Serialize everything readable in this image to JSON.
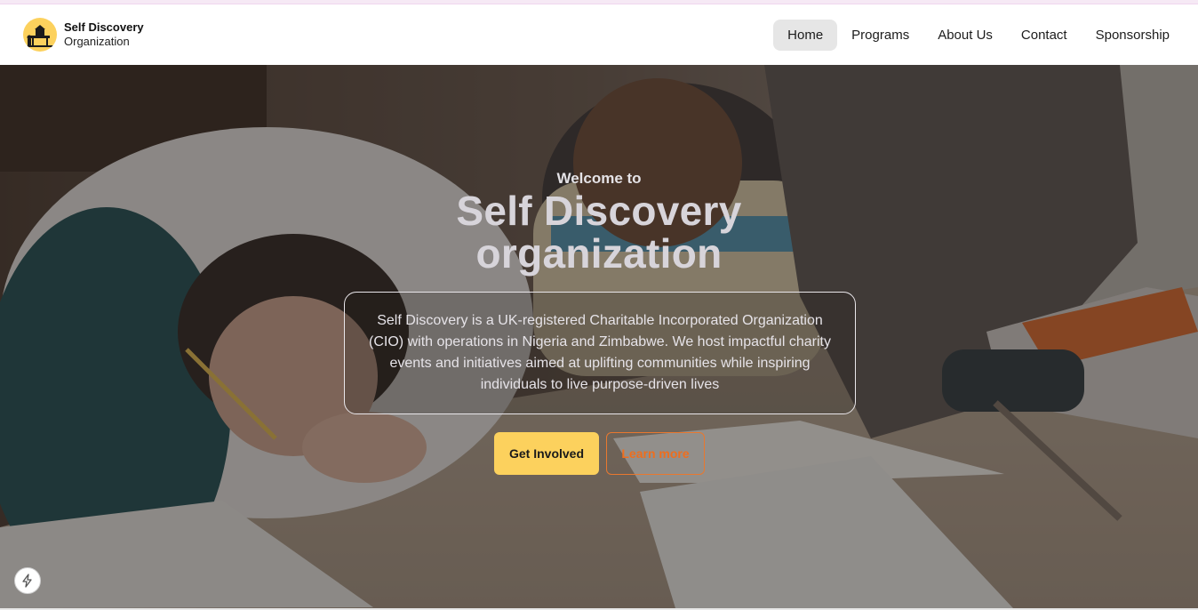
{
  "brand": {
    "name": "Self Discovery",
    "subtitle": "Organization",
    "logo_icon": "school-desk-logo-icon",
    "logo_color": "#fcd15d"
  },
  "nav": {
    "items": [
      {
        "label": "Home",
        "active": true
      },
      {
        "label": "Programs",
        "active": false
      },
      {
        "label": "About Us",
        "active": false
      },
      {
        "label": "Contact",
        "active": false
      },
      {
        "label": "Sponsorship",
        "active": false
      }
    ]
  },
  "hero": {
    "welcome": "Welcome to",
    "title_line1": "Self Discovery",
    "title_line2": "organization",
    "description": "Self Discovery is a UK-registered Charitable Incorporated Organization (CIO) with operations in Nigeria and Zimbabwe. We host impactful charity events and initiatives aimed at uplifting communities while inspiring individuals to live purpose-driven lives",
    "primary_button": "Get Involved",
    "secondary_button": "Learn more",
    "background_icon": "students-writing-photo",
    "accent_color": "#fcd15d",
    "secondary_color": "#ef6e1d"
  },
  "floating": {
    "icon": "bolt-icon"
  }
}
